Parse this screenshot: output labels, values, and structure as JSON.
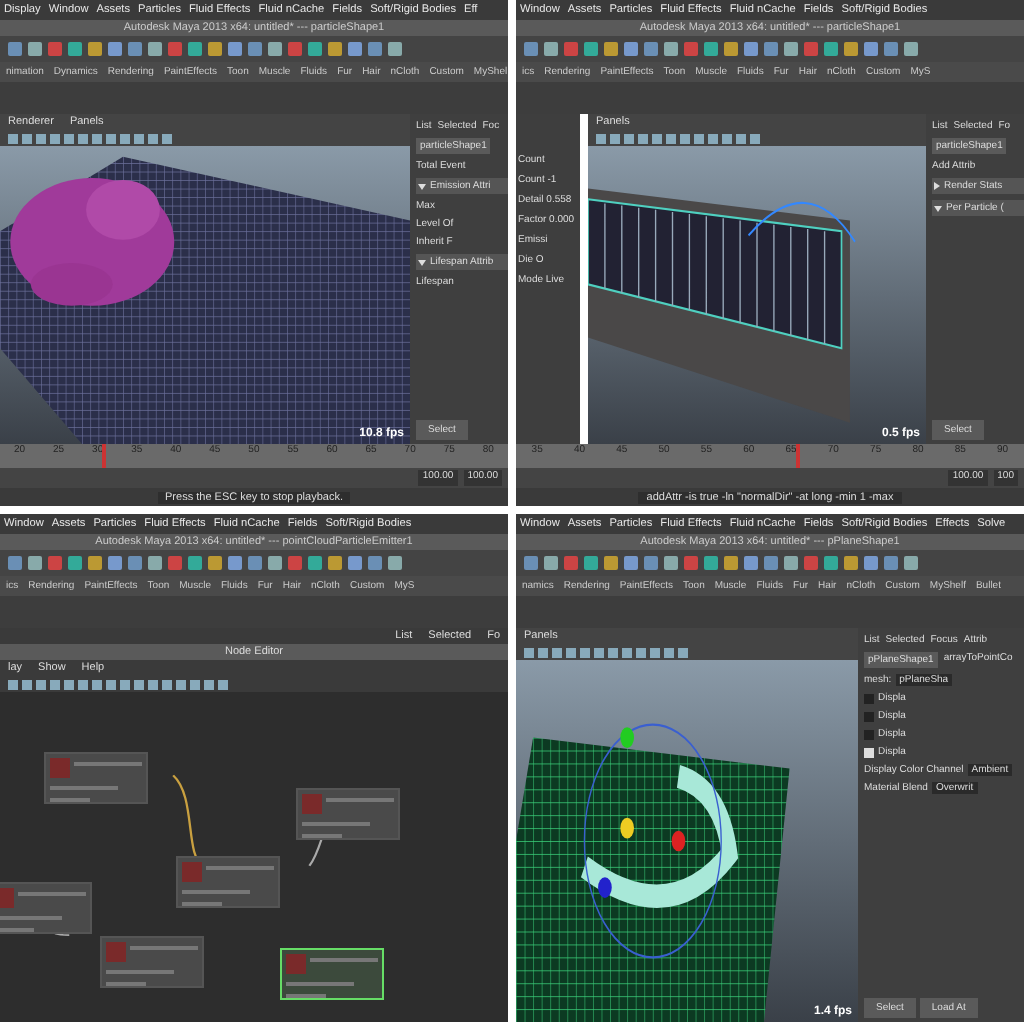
{
  "panels": [
    {
      "kind": "viewport",
      "viewport": {
        "kind": "particles"
      },
      "playhead": {
        "level": 0.2
      },
      "menu": [
        "Display",
        "Window",
        "Assets",
        "Particles",
        "Fluid Effects",
        "Fluid nCache",
        "Fields",
        "Soft/Rigid Bodies",
        "Eff"
      ],
      "title": "Autodesk Maya 2013 x64: untitled*  ---  particleShape1",
      "shelf": [
        "nimation",
        "Dynamics",
        "Rendering",
        "PaintEffects",
        "Toon",
        "Muscle",
        "Fluids",
        "Fur",
        "Hair",
        "nCloth",
        "Custom",
        "MyShel"
      ],
      "view_menu": [
        "Renderer",
        "Panels"
      ],
      "fps": "10.8 fps",
      "editor_tabs": [
        "List",
        "Selected",
        "Foc"
      ],
      "node_tab": "particleShape1",
      "attributes": [
        {
          "kind": "field",
          "label": "Total Event"
        },
        {
          "kind": "section",
          "label": "Emission Attri",
          "expanded": true
        },
        {
          "kind": "field",
          "label": "Max"
        },
        {
          "kind": "field",
          "label": "Level Of"
        },
        {
          "kind": "field",
          "label": "Inherit F"
        },
        {
          "kind": "section",
          "label": "Lifespan Attrib",
          "expanded": true
        },
        {
          "kind": "field",
          "label": "Lifespan"
        }
      ],
      "buttons": [
        "Select"
      ],
      "ticks": [
        "20",
        "25",
        "30",
        "35",
        "40",
        "45",
        "50",
        "55",
        "60",
        "65",
        "70",
        "75",
        "80"
      ],
      "range": [
        "100.00",
        "100.00"
      ],
      "help": "Press the ESC key to stop playback."
    },
    {
      "kind": "viewport",
      "viewport": {
        "kind": "fence"
      },
      "playhead": {
        "level": 0.55
      },
      "strip": [
        "Count",
        "Count -1",
        "Detail 0.558",
        "Factor 0.000",
        "Emissi",
        "Die O",
        "Mode Live"
      ],
      "menu": [
        "Window",
        "Assets",
        "Particles",
        "Fluid Effects",
        "Fluid nCache",
        "Fields",
        "Soft/Rigid Bodies"
      ],
      "title": "Autodesk Maya 2013 x64: untitled*  ---  particleShape1",
      "shelf": [
        "ics",
        "Rendering",
        "PaintEffects",
        "Toon",
        "Muscle",
        "Fluids",
        "Fur",
        "Hair",
        "nCloth",
        "Custom",
        "MyS"
      ],
      "view_menu": [
        "Panels"
      ],
      "fps": "0.5 fps",
      "editor_tabs": [
        "List",
        "Selected",
        "Fo"
      ],
      "node_tab": "particleShape1",
      "attributes": [
        {
          "kind": "field",
          "label": "Add Attrib"
        },
        {
          "kind": "section",
          "label": "Render Stats",
          "expanded": false
        },
        {
          "kind": "section",
          "label": "Per Particle (",
          "expanded": true
        }
      ],
      "buttons": [
        "Select"
      ],
      "ticks": [
        "35",
        "40",
        "45",
        "50",
        "55",
        "60",
        "65",
        "70",
        "75",
        "80",
        "85",
        "90"
      ],
      "range": [
        "100.00",
        "100"
      ],
      "help": "addAttr -is true -ln \"normalDir\" -at long -min 1 -max"
    },
    {
      "kind": "node_editor",
      "menu": [
        "Window",
        "Assets",
        "Particles",
        "Fluid Effects",
        "Fluid nCache",
        "Fields",
        "Soft/Rigid Bodies"
      ],
      "title": "Autodesk Maya 2013 x64: untitled*  ---  pointCloudParticleEmitter1",
      "shelf": [
        "ics",
        "Rendering",
        "PaintEffects",
        "Toon",
        "Muscle",
        "Fluids",
        "Fur",
        "Hair",
        "nCloth",
        "Custom",
        "MyS"
      ],
      "view_menu": [
        "List",
        "Selected",
        "Fo"
      ],
      "editor_title": "Node Editor",
      "editor_menu": [
        "lay",
        "Show",
        "Help"
      ],
      "nodes": [
        {
          "selected": false
        },
        {
          "selected": false
        },
        {
          "selected": false
        },
        {
          "selected": false
        },
        {
          "selected": false
        },
        {
          "selected": true
        }
      ]
    },
    {
      "kind": "viewport",
      "viewport": {
        "kind": "plane"
      },
      "menu": [
        "Window",
        "Assets",
        "Particles",
        "Fluid Effects",
        "Fluid nCache",
        "Fields",
        "Soft/Rigid Bodies",
        "Effects",
        "Solve"
      ],
      "title": "Autodesk Maya 2013 x64: untitled*  ---  pPlaneShape1",
      "shelf": [
        "namics",
        "Rendering",
        "PaintEffects",
        "Toon",
        "Muscle",
        "Fluids",
        "Fur",
        "Hair",
        "nCloth",
        "Custom",
        "MyShelf",
        "Bullet"
      ],
      "view_menu": [
        "Panels"
      ],
      "fps": "1.4 fps",
      "editor_tabs": [
        "List",
        "Selected",
        "Focus",
        "Attrib"
      ],
      "node_tab": "pPlaneShape1",
      "node_tab2": "arrayToPointCo",
      "mesh_label": "mesh:",
      "mesh_value": "pPlaneSha",
      "attributes": [
        {
          "kind": "check",
          "label": "Displa",
          "checked": false
        },
        {
          "kind": "check",
          "label": "Displa",
          "checked": false
        },
        {
          "kind": "check",
          "label": "Displa",
          "checked": false
        },
        {
          "kind": "check",
          "label": "Displa",
          "checked": true
        },
        {
          "kind": "field",
          "label": "Display Color Channel",
          "value": "Ambient"
        },
        {
          "kind": "field",
          "label": "Material Blend",
          "value": "Overwrit"
        }
      ],
      "buttons": [
        "Select",
        "Load At"
      ]
    }
  ]
}
